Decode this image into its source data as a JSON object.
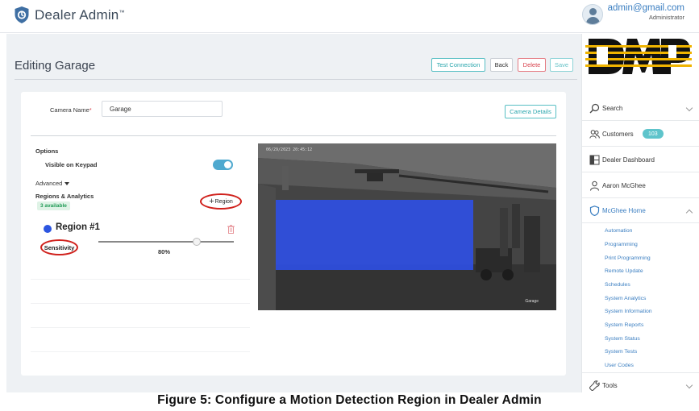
{
  "app": {
    "title": "Dealer Admin",
    "trademark": "™"
  },
  "user": {
    "email": "admin@gmail.com",
    "role": "Administrator"
  },
  "page": {
    "title": "Editing Garage",
    "buttons": {
      "test_connection": "Test Connection",
      "back": "Back",
      "delete": "Delete",
      "save": "Save"
    }
  },
  "form": {
    "camera_name_label": "Camera Name",
    "required_mark": "*",
    "camera_name_value": "Garage",
    "camera_details_button": "Camera Details",
    "options_title": "Options",
    "visible_on_keypad_label": "Visible on Keypad",
    "visible_on_keypad_enabled": true,
    "advanced_label": "Advanced",
    "regions_title": "Regions & Analytics",
    "available_badge": "3 available",
    "add_region_plus": "+",
    "add_region_button": "Region",
    "region_name": "Region #1",
    "region_color": "#2c55e0",
    "sensitivity_label": "Sensitivity",
    "sensitivity_value": "80%",
    "sensitivity_fraction": 0.8
  },
  "camera": {
    "timestamp": "06/29/2023 20:45:12",
    "caption": "Garage",
    "region_color": "rgba(45,80,235,0.88)"
  },
  "sidebar": {
    "brand": "DMP",
    "items": [
      {
        "icon": "search-icon",
        "label": "Search"
      },
      {
        "icon": "people-icon",
        "label": "Customers",
        "badge": "103"
      },
      {
        "icon": "dashboard-icon",
        "label": "Dealer Dashboard"
      },
      {
        "icon": "user-icon",
        "label": "Aaron McGhee"
      },
      {
        "icon": "shield-icon",
        "label": "McGhee Home"
      }
    ],
    "sub_items": [
      "Automation",
      "Programming",
      "Print Programming",
      "Remote Update",
      "Schedules",
      "System Analytics",
      "System Information",
      "System Reports",
      "System Status",
      "System Tests",
      "User Codes"
    ],
    "tools_label": "Tools"
  },
  "caption": "Figure 5:  Configure a Motion Detection Region in Dealer Admin",
  "colors": {
    "accent_teal": "#2aa6ad",
    "link_blue": "#3a7ec1",
    "danger": "#d8434e",
    "annotation_red": "#d0211c"
  }
}
